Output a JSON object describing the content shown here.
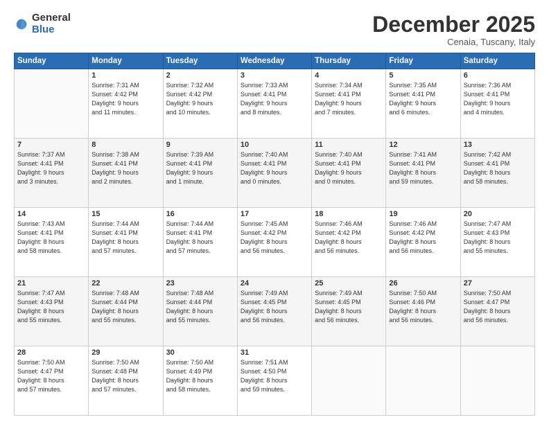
{
  "logo": {
    "general": "General",
    "blue": "Blue"
  },
  "title": "December 2025",
  "subtitle": "Cenaia, Tuscany, Italy",
  "days_of_week": [
    "Sunday",
    "Monday",
    "Tuesday",
    "Wednesday",
    "Thursday",
    "Friday",
    "Saturday"
  ],
  "weeks": [
    [
      {
        "day": "",
        "info": ""
      },
      {
        "day": "1",
        "info": "Sunrise: 7:31 AM\nSunset: 4:42 PM\nDaylight: 9 hours\nand 11 minutes."
      },
      {
        "day": "2",
        "info": "Sunrise: 7:32 AM\nSunset: 4:42 PM\nDaylight: 9 hours\nand 10 minutes."
      },
      {
        "day": "3",
        "info": "Sunrise: 7:33 AM\nSunset: 4:41 PM\nDaylight: 9 hours\nand 8 minutes."
      },
      {
        "day": "4",
        "info": "Sunrise: 7:34 AM\nSunset: 4:41 PM\nDaylight: 9 hours\nand 7 minutes."
      },
      {
        "day": "5",
        "info": "Sunrise: 7:35 AM\nSunset: 4:41 PM\nDaylight: 9 hours\nand 6 minutes."
      },
      {
        "day": "6",
        "info": "Sunrise: 7:36 AM\nSunset: 4:41 PM\nDaylight: 9 hours\nand 4 minutes."
      }
    ],
    [
      {
        "day": "7",
        "info": "Sunrise: 7:37 AM\nSunset: 4:41 PM\nDaylight: 9 hours\nand 3 minutes."
      },
      {
        "day": "8",
        "info": "Sunrise: 7:38 AM\nSunset: 4:41 PM\nDaylight: 9 hours\nand 2 minutes."
      },
      {
        "day": "9",
        "info": "Sunrise: 7:39 AM\nSunset: 4:41 PM\nDaylight: 9 hours\nand 1 minute."
      },
      {
        "day": "10",
        "info": "Sunrise: 7:40 AM\nSunset: 4:41 PM\nDaylight: 9 hours\nand 0 minutes."
      },
      {
        "day": "11",
        "info": "Sunrise: 7:40 AM\nSunset: 4:41 PM\nDaylight: 9 hours\nand 0 minutes."
      },
      {
        "day": "12",
        "info": "Sunrise: 7:41 AM\nSunset: 4:41 PM\nDaylight: 8 hours\nand 59 minutes."
      },
      {
        "day": "13",
        "info": "Sunrise: 7:42 AM\nSunset: 4:41 PM\nDaylight: 8 hours\nand 58 minutes."
      }
    ],
    [
      {
        "day": "14",
        "info": "Sunrise: 7:43 AM\nSunset: 4:41 PM\nDaylight: 8 hours\nand 58 minutes."
      },
      {
        "day": "15",
        "info": "Sunrise: 7:44 AM\nSunset: 4:41 PM\nDaylight: 8 hours\nand 57 minutes."
      },
      {
        "day": "16",
        "info": "Sunrise: 7:44 AM\nSunset: 4:41 PM\nDaylight: 8 hours\nand 57 minutes."
      },
      {
        "day": "17",
        "info": "Sunrise: 7:45 AM\nSunset: 4:42 PM\nDaylight: 8 hours\nand 56 minutes."
      },
      {
        "day": "18",
        "info": "Sunrise: 7:46 AM\nSunset: 4:42 PM\nDaylight: 8 hours\nand 56 minutes."
      },
      {
        "day": "19",
        "info": "Sunrise: 7:46 AM\nSunset: 4:42 PM\nDaylight: 8 hours\nand 56 minutes."
      },
      {
        "day": "20",
        "info": "Sunrise: 7:47 AM\nSunset: 4:43 PM\nDaylight: 8 hours\nand 55 minutes."
      }
    ],
    [
      {
        "day": "21",
        "info": "Sunrise: 7:47 AM\nSunset: 4:43 PM\nDaylight: 8 hours\nand 55 minutes."
      },
      {
        "day": "22",
        "info": "Sunrise: 7:48 AM\nSunset: 4:44 PM\nDaylight: 8 hours\nand 55 minutes."
      },
      {
        "day": "23",
        "info": "Sunrise: 7:48 AM\nSunset: 4:44 PM\nDaylight: 8 hours\nand 55 minutes."
      },
      {
        "day": "24",
        "info": "Sunrise: 7:49 AM\nSunset: 4:45 PM\nDaylight: 8 hours\nand 56 minutes."
      },
      {
        "day": "25",
        "info": "Sunrise: 7:49 AM\nSunset: 4:45 PM\nDaylight: 8 hours\nand 56 minutes."
      },
      {
        "day": "26",
        "info": "Sunrise: 7:50 AM\nSunset: 4:46 PM\nDaylight: 8 hours\nand 56 minutes."
      },
      {
        "day": "27",
        "info": "Sunrise: 7:50 AM\nSunset: 4:47 PM\nDaylight: 8 hours\nand 56 minutes."
      }
    ],
    [
      {
        "day": "28",
        "info": "Sunrise: 7:50 AM\nSunset: 4:47 PM\nDaylight: 8 hours\nand 57 minutes."
      },
      {
        "day": "29",
        "info": "Sunrise: 7:50 AM\nSunset: 4:48 PM\nDaylight: 8 hours\nand 57 minutes."
      },
      {
        "day": "30",
        "info": "Sunrise: 7:50 AM\nSunset: 4:49 PM\nDaylight: 8 hours\nand 58 minutes."
      },
      {
        "day": "31",
        "info": "Sunrise: 7:51 AM\nSunset: 4:50 PM\nDaylight: 8 hours\nand 59 minutes."
      },
      {
        "day": "",
        "info": ""
      },
      {
        "day": "",
        "info": ""
      },
      {
        "day": "",
        "info": ""
      }
    ]
  ]
}
